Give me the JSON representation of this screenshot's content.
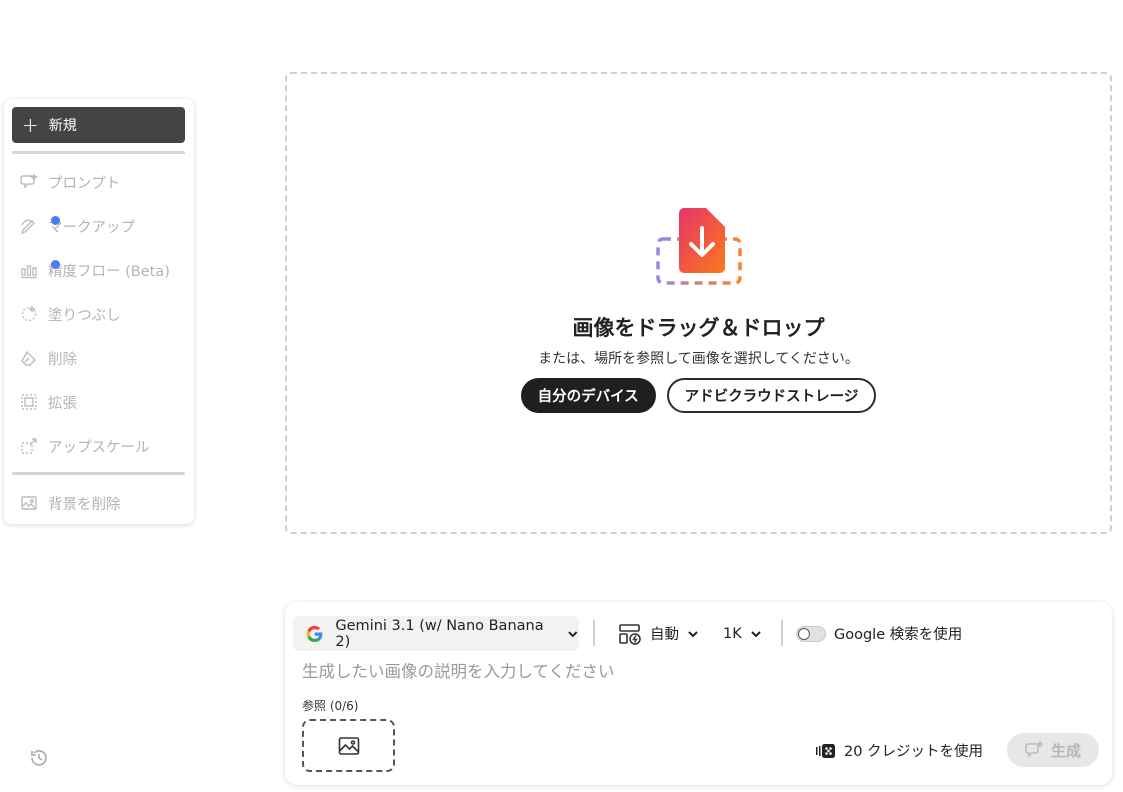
{
  "sidebar": {
    "new_label": "新規",
    "items": [
      {
        "label": "プロンプト",
        "icon": "prompt-icon"
      },
      {
        "label": "マークアップ",
        "icon": "markup-icon",
        "badge": true
      },
      {
        "label": "精度フロー (Beta)",
        "icon": "precision-flow-icon",
        "badge": true
      },
      {
        "label": "塗りつぶし",
        "icon": "fill-icon"
      },
      {
        "label": "削除",
        "icon": "erase-icon"
      },
      {
        "label": "拡張",
        "icon": "expand-icon"
      },
      {
        "label": "アップスケール",
        "icon": "upscale-icon"
      }
    ],
    "bottom_item": {
      "label": "背景を削除",
      "icon": "remove-background-icon"
    }
  },
  "dropzone": {
    "title": "画像をドラッグ＆ドロップ",
    "subtitle": "または、場所を参照して画像を選択してください。",
    "device_button": "自分のデバイス",
    "cloud_button": "アドビクラウドストレージ"
  },
  "prompt_panel": {
    "model": "Gemini 3.1 (w/ Nano Banana 2)",
    "aspect": "自動",
    "resolution": "1K",
    "google_search_label": "Google 検索を使用",
    "google_search_enabled": false,
    "placeholder": "生成したい画像の説明を入力してください",
    "reference_label": "参照 (0/6)",
    "credits": "20 クレジットを使用",
    "generate_label": "生成"
  },
  "colors": {
    "accent_dot": "#4a7bf0",
    "dark_button": "#1f1f1f",
    "new_button": "#444444"
  }
}
